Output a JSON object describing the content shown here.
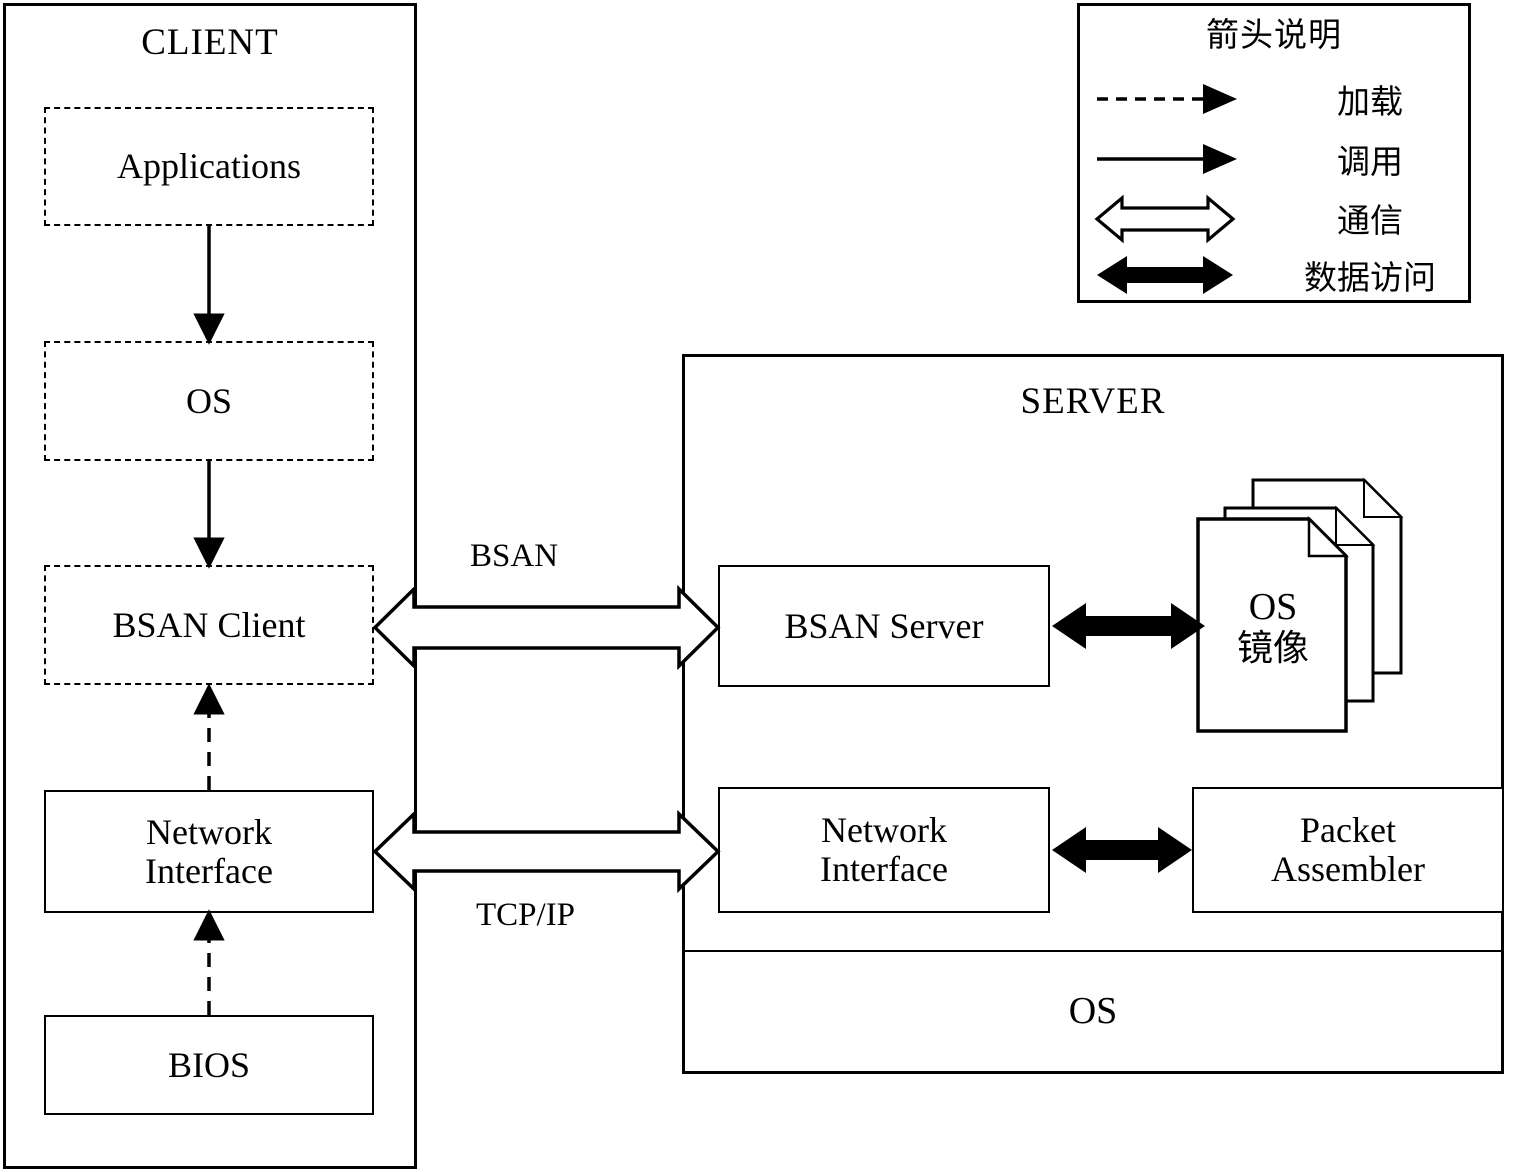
{
  "client": {
    "title": "CLIENT",
    "nodes": [
      {
        "id": "applications",
        "label": "Applications",
        "style": "dashed"
      },
      {
        "id": "os",
        "label": "OS",
        "style": "dashed"
      },
      {
        "id": "bsan_client",
        "label": "BSAN Client",
        "style": "dashed"
      },
      {
        "id": "network_interface",
        "label_line1": "Network",
        "label_line2": "Interface",
        "style": "solid"
      },
      {
        "id": "bios",
        "label": "BIOS",
        "style": "solid"
      }
    ]
  },
  "server": {
    "title": "SERVER",
    "nodes": [
      {
        "id": "bsan_server",
        "label": "BSAN Server",
        "style": "solid"
      },
      {
        "id": "os_image",
        "label_line1": "OS",
        "label_line2": "镜像",
        "style": "document-stack"
      },
      {
        "id": "network_interface",
        "label_line1": "Network",
        "label_line2": "Interface",
        "style": "solid"
      },
      {
        "id": "packet_assembler",
        "label_line1": "Packet",
        "label_line2": "Assembler",
        "style": "solid"
      },
      {
        "id": "os_band",
        "label": "OS",
        "style": "band"
      }
    ]
  },
  "connectors": {
    "bsan_label": "BSAN",
    "tcpip_label": "TCP/IP"
  },
  "legend": {
    "title": "箭头说明",
    "rows": [
      {
        "glyph": "dashed-arrow-icon",
        "label": "加载"
      },
      {
        "glyph": "solid-arrow-icon",
        "label": "调用"
      },
      {
        "glyph": "hollow-double-arrow-icon",
        "label": "通信"
      },
      {
        "glyph": "filled-double-arrow-icon",
        "label": "数据访问"
      }
    ]
  },
  "colors": {
    "stroke": "#000000",
    "background": "#ffffff"
  }
}
